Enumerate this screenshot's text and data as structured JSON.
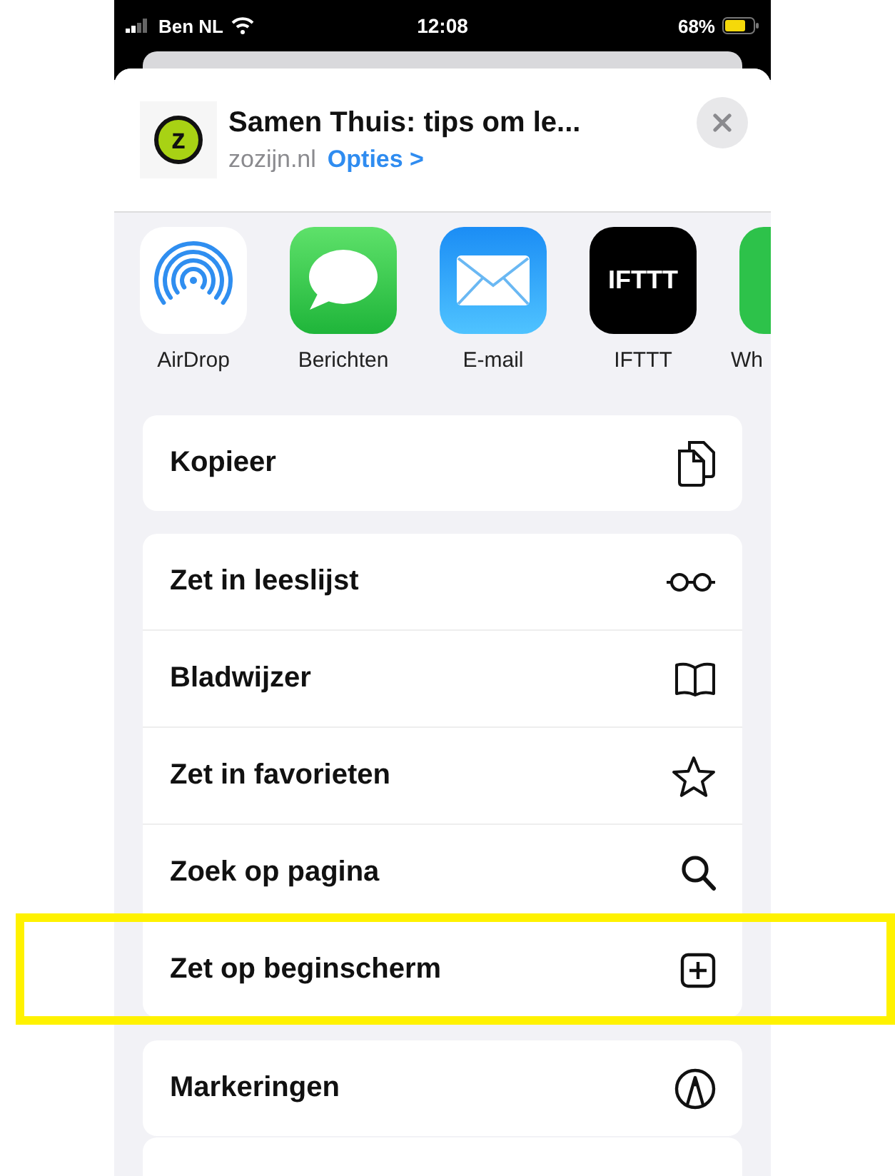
{
  "status_bar": {
    "carrier": "Ben NL",
    "time": "12:08",
    "battery": "68%"
  },
  "share_header": {
    "logo_text": "z",
    "title": "Samen Thuis: tips om le...",
    "domain": "zozijn.nl",
    "options_link": "Opties >"
  },
  "apps": [
    {
      "label": "AirDrop"
    },
    {
      "label": "Berichten"
    },
    {
      "label": "E-mail"
    },
    {
      "label": "IFTTT",
      "icon_text": "IFTTT"
    },
    {
      "label": "Wh"
    }
  ],
  "action_groups": [
    {
      "items": [
        {
          "label": "Kopieer",
          "highlighted": false
        }
      ]
    },
    {
      "items": [
        {
          "label": "Zet in leeslijst",
          "highlighted": false
        },
        {
          "label": "Bladwijzer",
          "highlighted": false
        },
        {
          "label": "Zet in favorieten",
          "highlighted": false
        },
        {
          "label": "Zoek op pagina",
          "highlighted": false
        },
        {
          "label": "Zet op beginscherm",
          "highlighted": true
        }
      ]
    },
    {
      "items": [
        {
          "label": "Markeringen",
          "highlighted": false
        }
      ]
    }
  ]
}
